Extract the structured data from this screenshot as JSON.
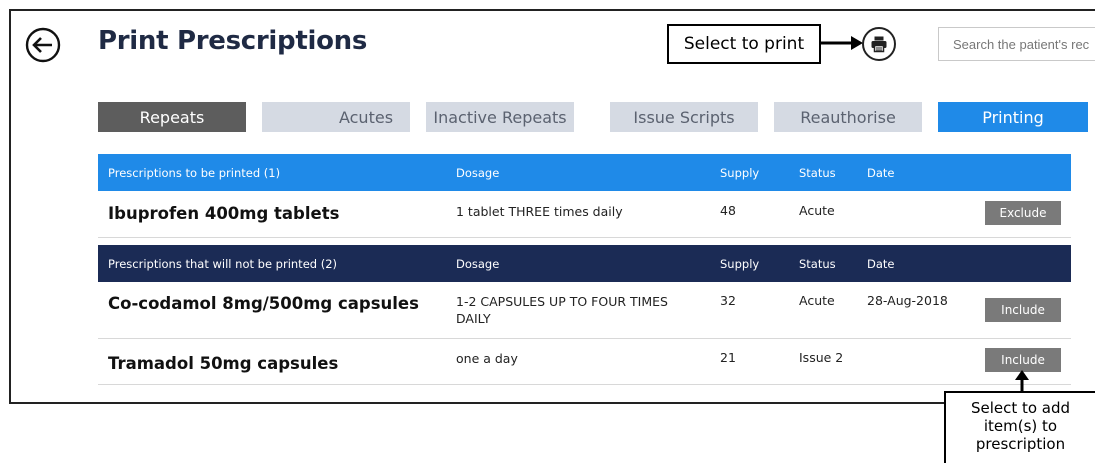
{
  "header": {
    "title": "Print Prescriptions",
    "search_placeholder": "Search the patient's rec"
  },
  "callouts": {
    "print": "Select to print",
    "add_line1": "Select to add",
    "add_line2": "item(s) to",
    "add_line3": "prescription"
  },
  "tabs": [
    {
      "label": "Repeats",
      "state": "selected"
    },
    {
      "label": "Acutes",
      "state": "normal"
    },
    {
      "label": "Inactive Repeats",
      "state": "normal"
    },
    {
      "label": "Issue Scripts",
      "state": "normal"
    },
    {
      "label": "Reauthorise",
      "state": "normal"
    },
    {
      "label": "Printing",
      "state": "active"
    }
  ],
  "columns": {
    "dosage": "Dosage",
    "supply": "Supply",
    "status": "Status",
    "date": "Date"
  },
  "groups": {
    "to_print": {
      "title": "Prescriptions to be printed (1)",
      "rows": [
        {
          "name": "Ibuprofen 400mg tablets",
          "dosage": "1 tablet THREE times daily",
          "supply": "48",
          "status": "Acute",
          "date": "",
          "action": "Exclude"
        }
      ]
    },
    "not_printed": {
      "title": "Prescriptions that will not be printed (2)",
      "rows": [
        {
          "name": "Co-codamol 8mg/500mg capsules",
          "dosage": "1-2 CAPSULES UP TO FOUR TIMES DAILY",
          "supply": "32",
          "status": "Acute",
          "date": "28-Aug-2018",
          "action": "Include"
        },
        {
          "name": "Tramadol 50mg capsules",
          "dosage": "one a day",
          "supply": "21",
          "status": "Issue 2",
          "date": "",
          "action": "Include"
        }
      ]
    }
  },
  "colors": {
    "primary_blue": "#1f8ae8",
    "navy": "#1b2b55",
    "tab_selected": "#5d5d5d",
    "tab_inactive": "#d5dae3",
    "button_gray": "#7a7a7a"
  },
  "icons": {
    "back": "back-arrow-icon",
    "print": "printer-icon"
  }
}
